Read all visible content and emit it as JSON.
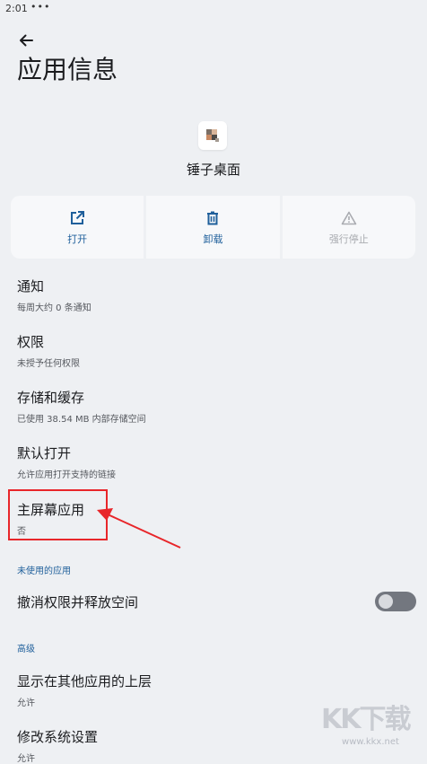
{
  "status_bar": {
    "time": "2:01",
    "dots": "•••"
  },
  "header": {
    "title": "应用信息"
  },
  "app": {
    "name": "锤子桌面"
  },
  "actions": [
    {
      "label": "打开",
      "icon": "open-external-icon",
      "enabled": true
    },
    {
      "label": "卸载",
      "icon": "trash-icon",
      "enabled": true
    },
    {
      "label": "强行停止",
      "icon": "warning-icon",
      "enabled": false
    }
  ],
  "settings": [
    {
      "title": "通知",
      "subtitle": "每周大约 0 条通知"
    },
    {
      "title": "权限",
      "subtitle": "未授予任何权限"
    },
    {
      "title": "存储和缓存",
      "subtitle": "已使用 38.54 MB 内部存储空间"
    },
    {
      "title": "默认打开",
      "subtitle": "允许应用打开支持的链接"
    },
    {
      "title": "主屏幕应用",
      "subtitle": "否"
    }
  ],
  "unused_section": {
    "header": "未使用的应用",
    "toggle_label": "撤消权限并释放空间",
    "toggle_on": false
  },
  "advanced_section": {
    "header": "高级",
    "items": [
      {
        "title": "显示在其他应用的上层",
        "subtitle": "允许"
      },
      {
        "title": "修改系统设置",
        "subtitle": "允许"
      }
    ]
  },
  "watermark": {
    "big": "KK下载",
    "small": "www.kkx.net"
  },
  "colors": {
    "accent": "#1f5f9b",
    "highlight": "#e8262a",
    "background": "#eef0f3"
  }
}
